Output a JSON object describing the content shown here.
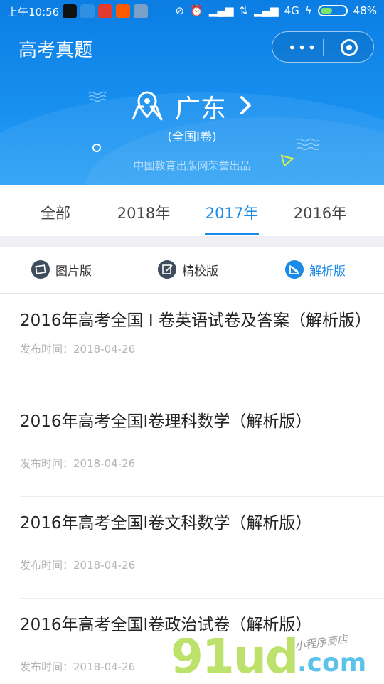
{
  "status_bar": {
    "time": "上午10:56",
    "network": "4G",
    "battery": "48%",
    "battery_level": 0.48,
    "app_icons": [
      "qq-icon",
      "browser-icon",
      "news-icon",
      "taobao-icon",
      "notes-icon"
    ],
    "colors": {
      "qq": "#111111",
      "browser": "#2f8fe3",
      "news": "#e23b2e",
      "taobao": "#ff5a00",
      "notes": "#7aa0c8"
    }
  },
  "header": {
    "title": "高考真题",
    "province": "广东",
    "exam_paper": "(全国I卷)",
    "publisher": "中国教育出版网荣誉出品"
  },
  "year_tabs": [
    {
      "label": "全部",
      "active": false
    },
    {
      "label": "2018年",
      "active": false
    },
    {
      "label": "2017年",
      "active": true
    },
    {
      "label": "2016年",
      "active": false
    }
  ],
  "versions": [
    {
      "label": "图片版",
      "icon": "picture-icon",
      "active": false
    },
    {
      "label": "精校版",
      "icon": "edit-icon",
      "active": false
    },
    {
      "label": "解析版",
      "icon": "analysis-icon",
      "active": true
    }
  ],
  "papers": [
    {
      "title": "2016年高考全国 Ⅰ 卷英语试卷及答案（解析版）",
      "date": "发布时间：2018-04-26"
    },
    {
      "title": "2016年高考全国I卷理科数学（解析版）",
      "date": "发布时间：2018-04-26"
    },
    {
      "title": "2016年高考全国I卷文科数学（解析版）",
      "date": "发布时间：2018-04-26"
    },
    {
      "title": "2016年高考全国I卷政治试卷（解析版）",
      "date": "发布时间：2018-04-26"
    }
  ],
  "watermark": {
    "main": "91ud",
    "domain": ".com",
    "tagline": "小程序商店"
  },
  "colors": {
    "accent": "#1a8ae6",
    "header_bg": "#1890f0"
  }
}
